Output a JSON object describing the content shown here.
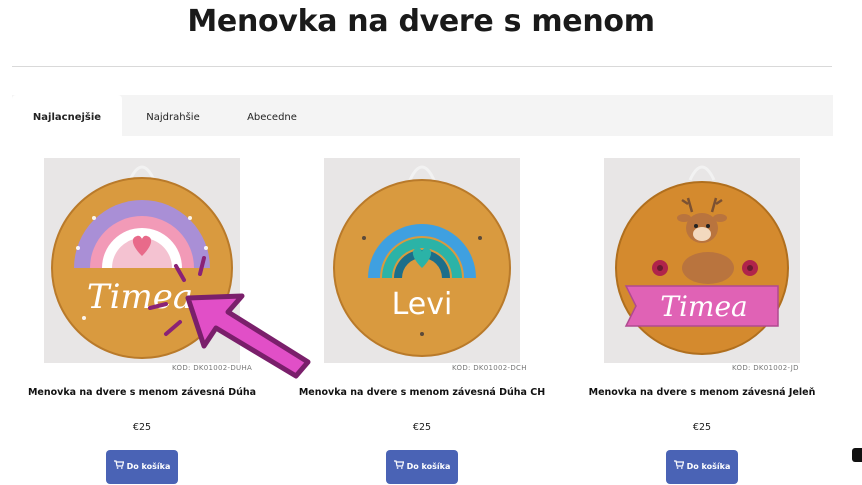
{
  "page": {
    "title": "Menovka na dvere s menom"
  },
  "tabs": [
    {
      "label": "Najlacnejšie",
      "active": true
    },
    {
      "label": "Najdrahšie",
      "active": false
    },
    {
      "label": "Abecedne",
      "active": false
    }
  ],
  "products": [
    {
      "name": "Menovka na dvere s menom závesná Dúha",
      "code": "KÓD: DK01002-DUHA",
      "price": "€25",
      "button_label": "Do košíka",
      "plaque_text": "Timea"
    },
    {
      "name": "Menovka na dvere s menom závesná Dúha CH",
      "code": "KÓD: DK01002-DCH",
      "price": "€25",
      "button_label": "Do košíka",
      "plaque_text": "Levi"
    },
    {
      "name": "Menovka na dvere s menom závesná Jeleň",
      "code": "KÓD: DK01002-JD",
      "price": "€25",
      "button_label": "Do košíka",
      "plaque_text": "Timea"
    }
  ],
  "icons": {
    "cart": "shopping-cart-icon",
    "annotation": "pointer-arrow-icon"
  },
  "colors": {
    "accent_button": "#4a63b5",
    "tabs_background": "#f4f4f4",
    "annotation_arrow": "#e14fc7",
    "plaque_wood": "#d99a3f"
  }
}
